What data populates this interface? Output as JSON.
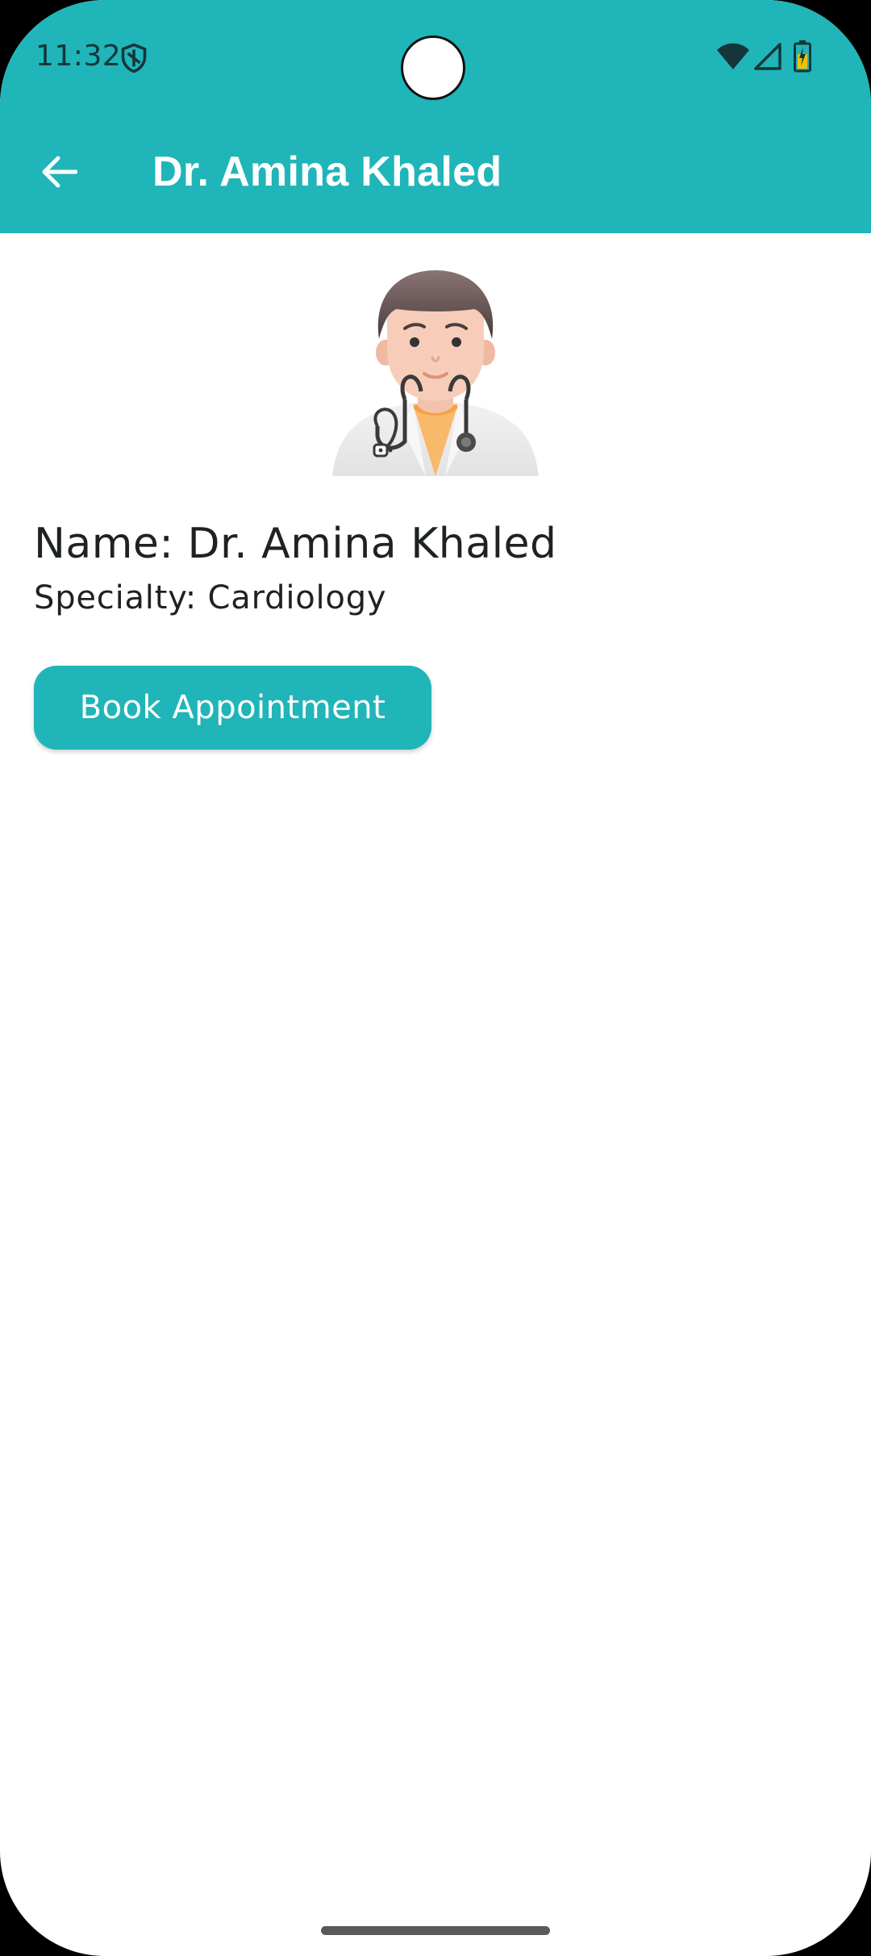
{
  "status_bar": {
    "time": "11:32",
    "icons": [
      "shield-icon",
      "wifi-icon",
      "signal-icon",
      "battery-icon"
    ]
  },
  "app_bar": {
    "title": "Dr. Amina Khaled",
    "back_icon": "arrow-left-icon"
  },
  "doctor": {
    "avatar_icon": "doctor-avatar-icon",
    "name_text": "Name: Dr. Amina Khaled",
    "specialty_text": "Specialty: Cardiology"
  },
  "actions": {
    "book_label": "Book Appointment"
  },
  "colors": {
    "primary": "#20b5b8",
    "on_primary": "#ffffff",
    "text": "#1f2224",
    "background": "#ffffff"
  }
}
